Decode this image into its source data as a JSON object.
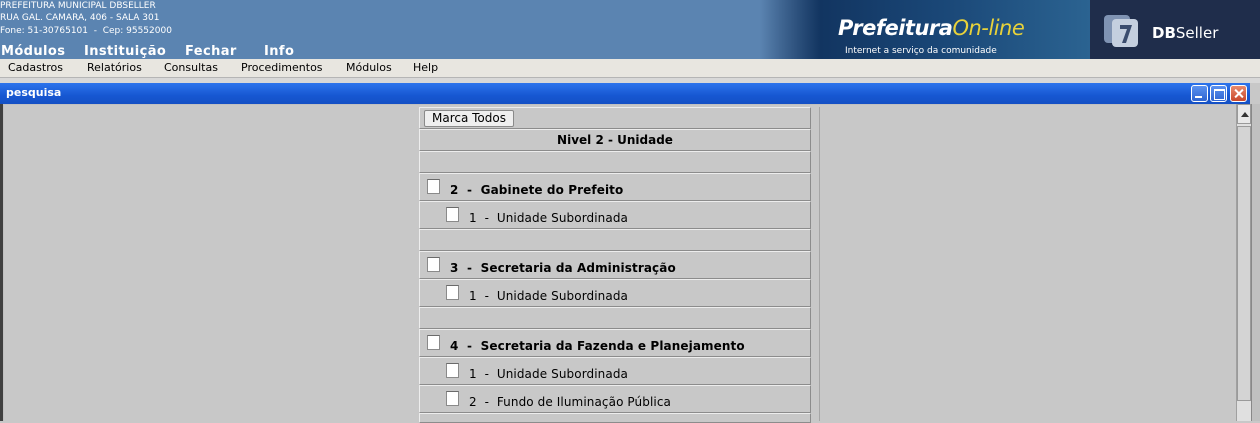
{
  "header": {
    "address_lines": [
      "PREFEITURA MUNICIPAL DBSELLER",
      "RUA GAL. CAMARA, 406 - SALA 301",
      "Fone: 51-30765101  -  Cep: 95552000"
    ],
    "top_menu": [
      "Módulos",
      "Instituição",
      "Fechar",
      "Info"
    ],
    "banner": {
      "logo_main": "Prefeitura",
      "logo_accent": "On-line",
      "tagline": "Internet a serviço da comunidade",
      "brand_bold": "DB",
      "brand_rest": "Seller"
    }
  },
  "menubar": [
    "Cadastros",
    "Relatórios",
    "Consultas",
    "Procedimentos",
    "Módulos",
    "Help"
  ],
  "window": {
    "title": "pesquisa"
  },
  "form": {
    "mark_all_label": "Marca Todos",
    "heading": "Nivel 2 - Unidade",
    "groups": [
      {
        "label": "2  -  Gabinete do Prefeito",
        "checked": false,
        "children": [
          {
            "label": "1  -  Unidade Subordinada",
            "checked": false
          }
        ]
      },
      {
        "label": "3  -  Secretaria da Administração",
        "checked": false,
        "children": [
          {
            "label": "1  -  Unidade Subordinada",
            "checked": false
          }
        ]
      },
      {
        "label": "4  -  Secretaria da Fazenda e Planejamento",
        "checked": false,
        "children": [
          {
            "label": "1  -  Unidade Subordinada",
            "checked": false
          },
          {
            "label": "2  -  Fundo de Iluminação Pública",
            "checked": false
          }
        ]
      }
    ]
  },
  "colors": {
    "header_bg": "#5b84b1",
    "titlebar": "#1657d2",
    "banner_accent": "#e8d23a"
  }
}
